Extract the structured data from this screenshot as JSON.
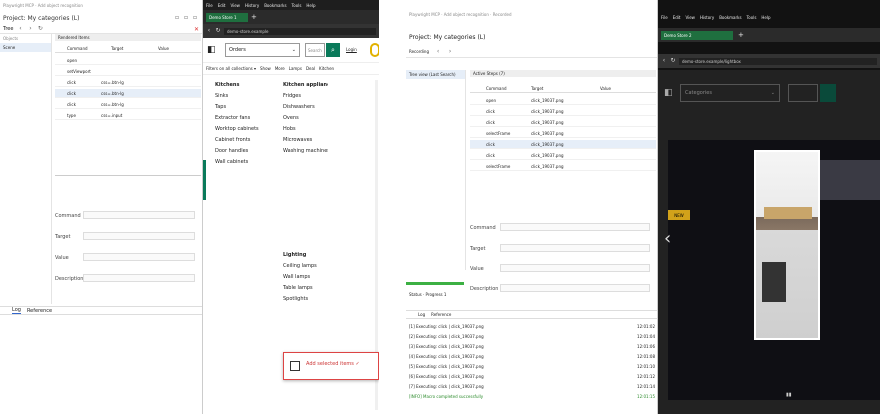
{
  "left": {
    "address": "Playwright MCP · Add object recognition",
    "title": "Project: My categories (L)",
    "toolbar_icons": [
      "save-icon",
      "copy-icon",
      "delete-icon"
    ],
    "nav": {
      "label": "Tree",
      "icons": [
        "back-icon",
        "forward-icon",
        "refresh-icon"
      ]
    },
    "side": {
      "header": "Objects",
      "item": "Scene"
    },
    "table": {
      "header": "Rendered Items",
      "columns": [
        "Command",
        "Target",
        "Value"
      ],
      "rows": [
        [
          "open",
          "",
          ""
        ],
        [
          "setViewport",
          "",
          ""
        ],
        [
          "click",
          "css=.btn-lg",
          ""
        ],
        [
          "click",
          "css=.btn-lg",
          ""
        ],
        [
          "click",
          "css=.btn-lg",
          ""
        ],
        [
          "type",
          "css=.input",
          ""
        ]
      ]
    },
    "form": {
      "command": "Command",
      "target": "Target",
      "value": "Value",
      "description": "Description"
    },
    "log": {
      "tabs": [
        "Log",
        "Reference"
      ]
    }
  },
  "browser1": {
    "menu": [
      "File",
      "Edit",
      "View",
      "History",
      "Bookmarks",
      "Tools",
      "Help"
    ],
    "tab": "Demo Store 1",
    "address": "demo-store.example",
    "site": {
      "category": "Orders",
      "search": "Search",
      "link": "Login"
    },
    "subnav": "Filters on all collections ▾",
    "subnav_links": [
      "Show",
      "More",
      "Lamps",
      "Deal",
      "Kitchen"
    ],
    "columns": [
      {
        "title": "Kitchens",
        "items": [
          "Sinks",
          "Taps",
          "Extractor fans",
          "Worktop cabinets",
          "Cabinet fronts",
          "Door handles",
          "Wall cabinets"
        ]
      },
      {
        "title": "Kitchen appliances",
        "items": [
          "Fridges",
          "Dishwashers",
          "Ovens",
          "Hobs",
          "Microwaves",
          "Washing machines"
        ]
      },
      {
        "title": "Lighting",
        "items": [
          "Ceiling lamps",
          "Wall lamps",
          "Table lamps",
          "Spotlights"
        ]
      }
    ],
    "popup": "Add selected items ✓"
  },
  "right": {
    "address": "Playwright MCP · Add object recognition · Recorded",
    "title": "Project: My categories (L)",
    "nav": "Recording",
    "side": "Tree view (Last Search)",
    "table": {
      "header": "Active Steps (7)",
      "columns": [
        "Command",
        "Target",
        "Value"
      ],
      "rows": [
        [
          "open",
          "click_19037.png",
          ""
        ],
        [
          "click",
          "click_19037.png",
          ""
        ],
        [
          "click",
          "click_19037.png",
          ""
        ],
        [
          "selectFrame",
          "click_19037.png",
          ""
        ],
        [
          "click",
          "click_19037.png",
          ""
        ],
        [
          "click",
          "click_19037.png",
          ""
        ],
        [
          "selectFrame",
          "click_19037.png",
          ""
        ]
      ]
    },
    "form": {
      "command": "Command",
      "target": "Target",
      "value": "Value",
      "description": "Description"
    },
    "status": "Status · Progress 1",
    "logtabs": [
      "Log",
      "Reference"
    ],
    "log": [
      "[1] Executing: click | click_19037.png",
      "[2] Executing: click | click_19037.png",
      "[3] Executing: click | click_19037.png",
      "[4] Executing: click | click_19037.png",
      "[5] Executing: click | click_19037.png",
      "[6] Executing: click | click_19037.png",
      "[7] Executing: click | click_19037.png",
      "[INFO] Macro completed successfully"
    ],
    "log_times": [
      "12:01:02",
      "12:01:04",
      "12:01:06",
      "12:01:08",
      "12:01:10",
      "12:01:12",
      "12:01:14",
      "12:01:15"
    ]
  },
  "browser2": {
    "menu": [
      "File",
      "Edit",
      "View",
      "History",
      "Bookmarks",
      "Tools",
      "Help"
    ],
    "tab": "Demo Store 2",
    "address": "demo-store.example/lightbox",
    "dropdown": "Categories",
    "badge": "NEW",
    "arrow": "‹"
  }
}
